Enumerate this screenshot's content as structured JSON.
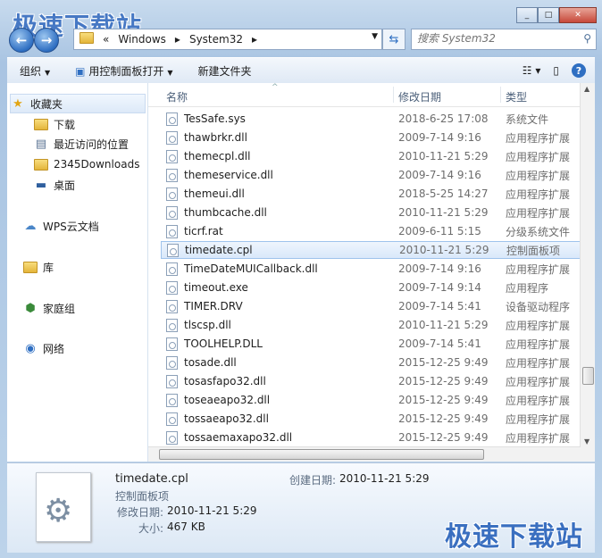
{
  "watermark": "极速下载站",
  "window": {
    "min": "_",
    "max": "□",
    "close": "✕"
  },
  "address": {
    "overflow": "«",
    "segments": [
      "Windows",
      "System32"
    ]
  },
  "search": {
    "placeholder": "搜索 System32"
  },
  "toolbar": {
    "organize": "组织",
    "open_with": "用控制面板打开",
    "new_folder": "新建文件夹"
  },
  "sidebar": {
    "favorites": "收藏夹",
    "items": [
      "下载",
      "最近访问的位置",
      "2345Downloads",
      "桌面"
    ],
    "wps": "WPS云文档",
    "libraries": "库",
    "homegroup": "家庭组",
    "network": "网络"
  },
  "columns": {
    "name": "名称",
    "date": "修改日期",
    "type": "类型"
  },
  "files": [
    {
      "name": "TesSafe.sys",
      "date": "2018-6-25 17:08",
      "type": "系统文件"
    },
    {
      "name": "thawbrkr.dll",
      "date": "2009-7-14 9:16",
      "type": "应用程序扩展"
    },
    {
      "name": "themecpl.dll",
      "date": "2010-11-21 5:29",
      "type": "应用程序扩展"
    },
    {
      "name": "themeservice.dll",
      "date": "2009-7-14 9:16",
      "type": "应用程序扩展"
    },
    {
      "name": "themeui.dll",
      "date": "2018-5-25 14:27",
      "type": "应用程序扩展"
    },
    {
      "name": "thumbcache.dll",
      "date": "2010-11-21 5:29",
      "type": "应用程序扩展"
    },
    {
      "name": "ticrf.rat",
      "date": "2009-6-11 5:15",
      "type": "分级系统文件"
    },
    {
      "name": "timedate.cpl",
      "date": "2010-11-21 5:29",
      "type": "控制面板项"
    },
    {
      "name": "TimeDateMUICallback.dll",
      "date": "2009-7-14 9:16",
      "type": "应用程序扩展"
    },
    {
      "name": "timeout.exe",
      "date": "2009-7-14 9:14",
      "type": "应用程序"
    },
    {
      "name": "TIMER.DRV",
      "date": "2009-7-14 5:41",
      "type": "设备驱动程序"
    },
    {
      "name": "tlscsp.dll",
      "date": "2010-11-21 5:29",
      "type": "应用程序扩展"
    },
    {
      "name": "TOOLHELP.DLL",
      "date": "2009-7-14 5:41",
      "type": "应用程序扩展"
    },
    {
      "name": "tosade.dll",
      "date": "2015-12-25 9:49",
      "type": "应用程序扩展"
    },
    {
      "name": "tosasfapo32.dll",
      "date": "2015-12-25 9:49",
      "type": "应用程序扩展"
    },
    {
      "name": "toseaeapo32.dll",
      "date": "2015-12-25 9:49",
      "type": "应用程序扩展"
    },
    {
      "name": "tossaeapo32.dll",
      "date": "2015-12-25 9:49",
      "type": "应用程序扩展"
    },
    {
      "name": "tossaemaxapo32.dll",
      "date": "2015-12-25 9:49",
      "type": "应用程序扩展"
    }
  ],
  "details": {
    "filename": "timedate.cpl",
    "filetype": "控制面板项",
    "modified_label": "修改日期:",
    "modified": "2010-11-21 5:29",
    "size_label": "大小:",
    "size": "467 KB",
    "created_label": "创建日期:",
    "created": "2010-11-21 5:29"
  }
}
